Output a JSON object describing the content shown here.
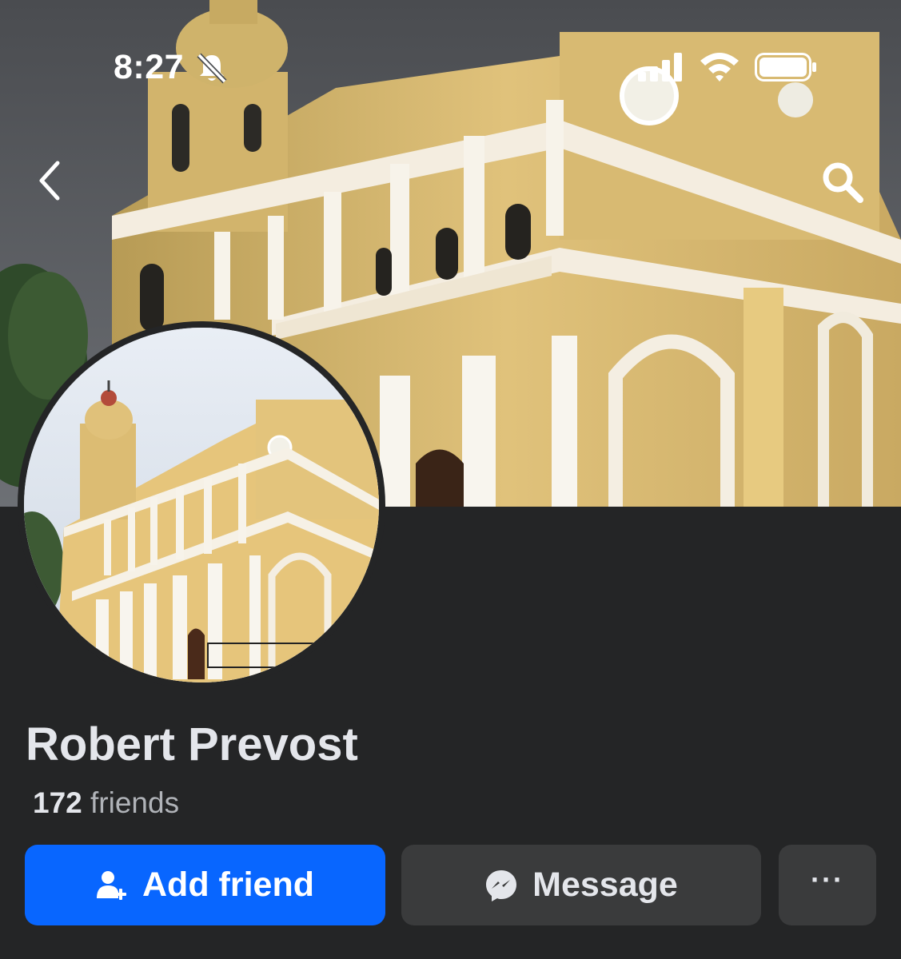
{
  "status_bar": {
    "time": "8:27"
  },
  "profile": {
    "name": "Robert Prevost",
    "friends_count": "172",
    "friends_label": "friends"
  },
  "actions": {
    "add_friend_label": "Add friend",
    "message_label": "Message",
    "more_label": "···"
  },
  "icons": {
    "silent": "bell-off-icon",
    "signal": "signal-icon",
    "wifi": "wifi-icon",
    "battery": "battery-icon",
    "back": "chevron-left-icon",
    "search": "search-icon",
    "add_friend": "person-add-icon",
    "message": "messenger-icon"
  },
  "colors": {
    "background": "#242526",
    "primary_button": "#0866ff",
    "secondary_button": "#3a3b3c",
    "facade": "#e8c97a"
  }
}
